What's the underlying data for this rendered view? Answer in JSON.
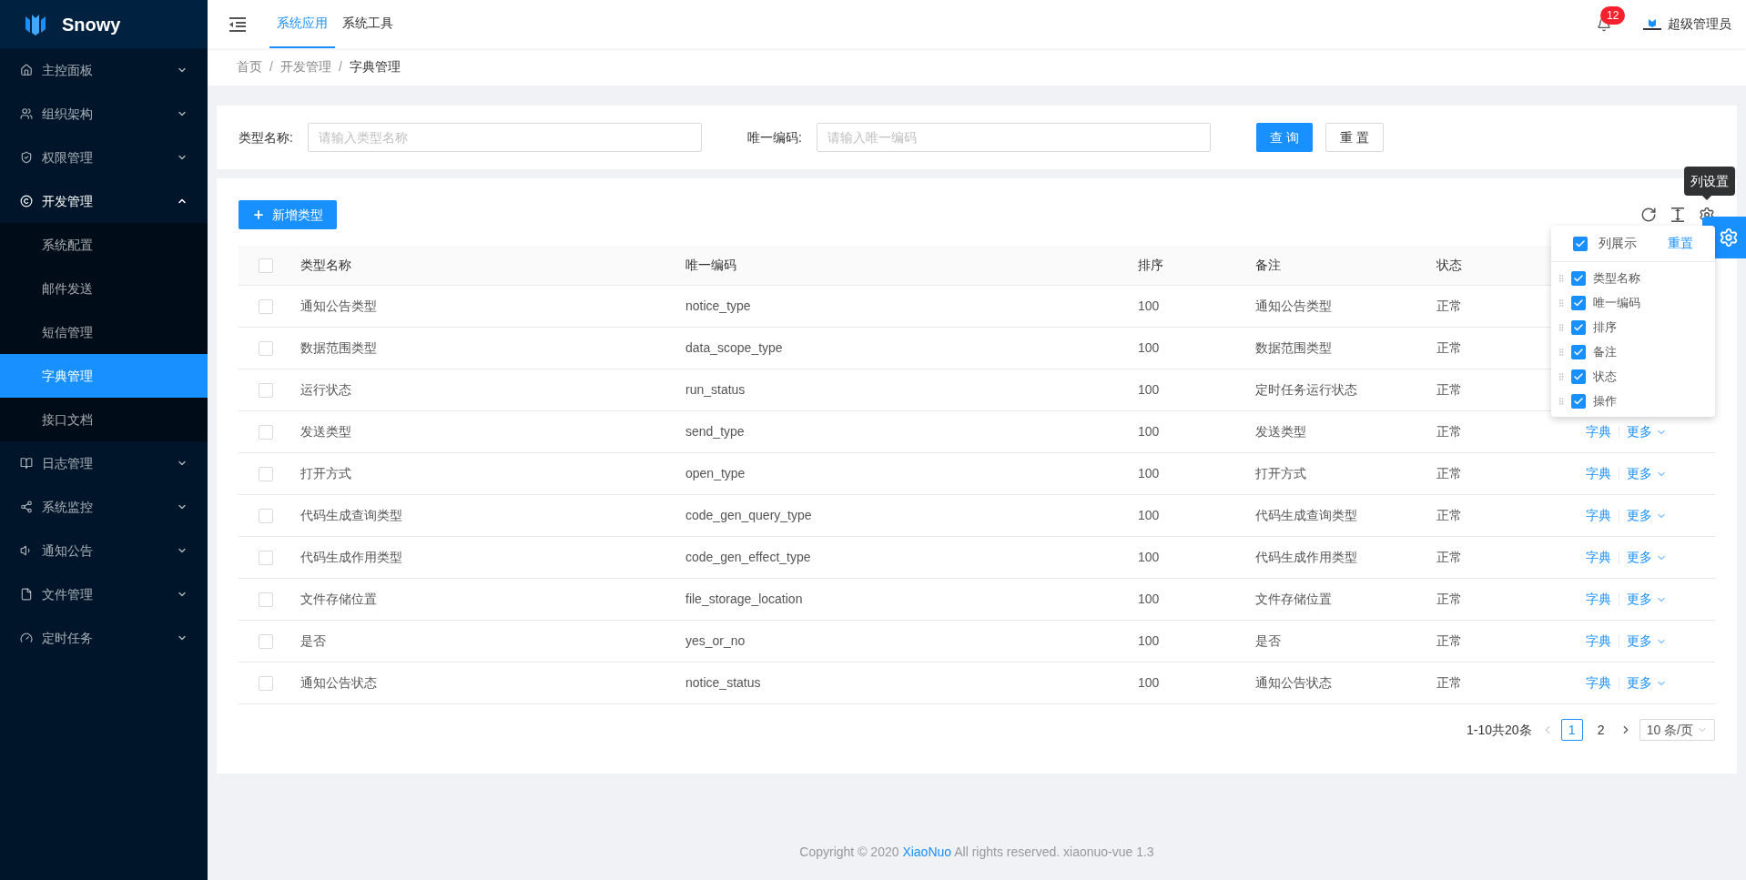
{
  "sidebar": {
    "logo": "Snowy",
    "items": [
      {
        "label": "主控面板",
        "expanded": false
      },
      {
        "label": "组织架构",
        "expanded": false
      },
      {
        "label": "权限管理",
        "expanded": false
      },
      {
        "label": "开发管理",
        "expanded": true,
        "children": [
          {
            "label": "系统配置",
            "selected": false
          },
          {
            "label": "邮件发送",
            "selected": false
          },
          {
            "label": "短信管理",
            "selected": false
          },
          {
            "label": "字典管理",
            "selected": true
          },
          {
            "label": "接口文档",
            "selected": false
          }
        ]
      },
      {
        "label": "日志管理",
        "expanded": false
      },
      {
        "label": "系统监控",
        "expanded": false
      },
      {
        "label": "通知公告",
        "expanded": false
      },
      {
        "label": "文件管理",
        "expanded": false
      },
      {
        "label": "定时任务",
        "expanded": false
      }
    ]
  },
  "header": {
    "tabs": [
      {
        "label": "系统应用",
        "selected": true
      },
      {
        "label": "系统工具",
        "selected": false
      }
    ],
    "notification_count": "12",
    "user": "超级管理员"
  },
  "breadcrumb": [
    "首页",
    "开发管理",
    "字典管理"
  ],
  "breadcrumb_separator": "/",
  "search": {
    "fields": [
      {
        "label": "类型名称:",
        "placeholder": "请输入类型名称"
      },
      {
        "label": "唯一编码:",
        "placeholder": "请输入唯一编码"
      }
    ],
    "query_button": "查 询",
    "reset_button": "重 置"
  },
  "toolbar": {
    "add_button": "新增类型",
    "tooltip": "列设置"
  },
  "table": {
    "header_checked": false,
    "columns": [
      "类型名称",
      "唯一编码",
      "排序",
      "备注",
      "状态"
    ],
    "rows": [
      {
        "checked": false,
        "cells": [
          "通知公告类型",
          "notice_type",
          "100",
          "通知公告类型",
          "正常"
        ]
      },
      {
        "checked": false,
        "cells": [
          "数据范围类型",
          "data_scope_type",
          "100",
          "数据范围类型",
          "正常"
        ]
      },
      {
        "checked": false,
        "cells": [
          "运行状态",
          "run_status",
          "100",
          "定时任务运行状态",
          "正常"
        ]
      },
      {
        "checked": false,
        "cells": [
          "发送类型",
          "send_type",
          "100",
          "发送类型",
          "正常"
        ],
        "actions": {
          "primary": "字典",
          "more": "更多"
        }
      },
      {
        "checked": false,
        "cells": [
          "打开方式",
          "open_type",
          "100",
          "打开方式",
          "正常"
        ],
        "actions": {
          "primary": "字典",
          "more": "更多"
        }
      },
      {
        "checked": false,
        "cells": [
          "代码生成查询类型",
          "code_gen_query_type",
          "100",
          "代码生成查询类型",
          "正常"
        ],
        "actions": {
          "primary": "字典",
          "more": "更多"
        }
      },
      {
        "checked": false,
        "cells": [
          "代码生成作用类型",
          "code_gen_effect_type",
          "100",
          "代码生成作用类型",
          "正常"
        ],
        "actions": {
          "primary": "字典",
          "more": "更多"
        }
      },
      {
        "checked": false,
        "cells": [
          "文件存储位置",
          "file_storage_location",
          "100",
          "文件存储位置",
          "正常"
        ],
        "actions": {
          "primary": "字典",
          "more": "更多"
        }
      },
      {
        "checked": false,
        "cells": [
          "是否",
          "yes_or_no",
          "100",
          "是否",
          "正常"
        ],
        "actions": {
          "primary": "字典",
          "more": "更多"
        }
      },
      {
        "checked": false,
        "cells": [
          "通知公告状态",
          "notice_status",
          "100",
          "通知公告状态",
          "正常"
        ],
        "actions": {
          "primary": "字典",
          "more": "更多"
        }
      }
    ]
  },
  "column_settings": {
    "label": "列展示",
    "checked": true,
    "reset": "重置",
    "items": [
      {
        "label": "类型名称",
        "checked": true
      },
      {
        "label": "唯一编码",
        "checked": true
      },
      {
        "label": "排序",
        "checked": true
      },
      {
        "label": "备注",
        "checked": true
      },
      {
        "label": "状态",
        "checked": true
      },
      {
        "label": "操作",
        "checked": true
      }
    ]
  },
  "pagination": {
    "total": "1-10共20条",
    "pages": [
      {
        "label": "1",
        "selected": true
      },
      {
        "label": "2",
        "selected": false
      }
    ],
    "page_size": "10 条/页"
  },
  "footer": {
    "prefix": "Copyright © 2020 ",
    "link": "XiaoNuo",
    "suffix": " All rights reserved. xiaonuo-vue 1.3"
  }
}
